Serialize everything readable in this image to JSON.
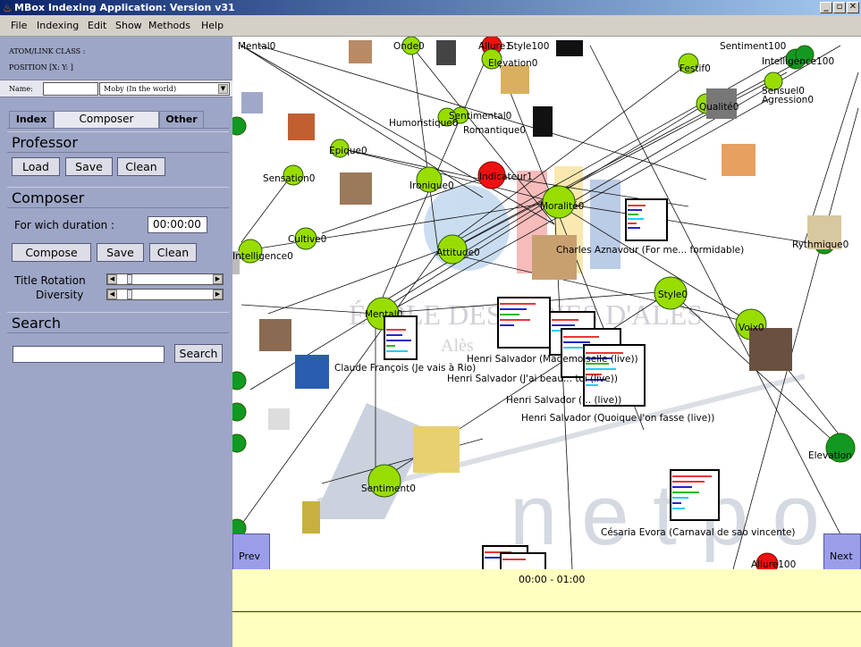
{
  "window": {
    "title": "MBox Indexing Application: Version v31"
  },
  "menu": [
    "File",
    "Indexing",
    "Edit",
    "Show",
    "Methods",
    "Help"
  ],
  "left_panel": {
    "atom_class": "ATOM/LINK CLASS :",
    "position": "POSITION [X:  Y:  ]",
    "name_label": "Name:",
    "name_value": "",
    "name_select": "Moby (In the world)",
    "tabs": {
      "index": "Index",
      "composer": "Composer",
      "other": "Other"
    },
    "professor": {
      "title": "Professor",
      "load": "Load",
      "save": "Save",
      "clean": "Clean"
    },
    "composer": {
      "title": "Composer",
      "duration_label": "For wich duration :",
      "duration_value": "00:00:00",
      "compose": "Compose",
      "save": "Save",
      "clean": "Clean",
      "title_rotation": "Title Rotation",
      "title_rotation_level": 0.1,
      "diversity": "Diversity",
      "diversity_level": 0.1
    },
    "search": {
      "title": "Search",
      "value": "",
      "button": "Search"
    }
  },
  "graph": {
    "watermark": {
      "school": "ÉCOLE DES MINES D'ALÈS",
      "city": "Alès",
      "word": "n e t p o"
    },
    "nodes": [
      {
        "label": "Mental0",
        "color": "#99dd00"
      },
      {
        "label": "Onde0",
        "color": "#99dd00"
      },
      {
        "label": "Allure1",
        "color": "#ee1111"
      },
      {
        "label": "Style100",
        "color": "#99dd00"
      },
      {
        "label": "Elevation0",
        "color": "#99dd00"
      },
      {
        "label": "Sentiment100",
        "color": "#99dd00"
      },
      {
        "label": "Festif0",
        "color": "#99dd00"
      },
      {
        "label": "Intelligence100",
        "color": "#119922"
      },
      {
        "label": "Sentimental0",
        "color": "#99dd00"
      },
      {
        "label": "Romantique0",
        "color": "#99dd00"
      },
      {
        "label": "Humoristique0",
        "color": "#99dd00"
      },
      {
        "label": "Qualité0",
        "color": "#99dd00"
      },
      {
        "label": "Sensuel0",
        "color": "#99dd00"
      },
      {
        "label": "Agression0",
        "color": "#99dd00"
      },
      {
        "label": "Epique0",
        "color": "#99dd00"
      },
      {
        "label": "Sensation0",
        "color": "#99dd00"
      },
      {
        "label": "Ironique0",
        "color": "#99dd00"
      },
      {
        "label": "Indicateur1",
        "color": "#ee1111"
      },
      {
        "label": "Moralité0",
        "color": "#99dd00"
      },
      {
        "label": "Cultive0",
        "color": "#99dd00"
      },
      {
        "label": "Intelligence0",
        "color": "#99dd00"
      },
      {
        "label": "Attitude0",
        "color": "#99dd00"
      },
      {
        "label": "Rythmique0",
        "color": "#119922"
      },
      {
        "label": "Style0",
        "color": "#99dd00"
      },
      {
        "label": "Voix0",
        "color": "#99dd00"
      },
      {
        "label": "Sentiment0",
        "color": "#99dd00"
      },
      {
        "label": "Elevation",
        "color": "#119922"
      },
      {
        "label": "Allure100",
        "color": "#ee1111"
      }
    ],
    "tracks": [
      "Charles Aznavour (For me... formidable)",
      "Claude François (Je vais à Rio)",
      "Henri Salvador (Mademoiselle (live))",
      "Henri Salvador (J'ai beau... toi (live))",
      "Henri Salvador (... (live))",
      "Henri Salvador (Quoique l'on fasse (live))",
      "Césaria Evora (Carnaval de sao vincente)"
    ],
    "buttons": {
      "prev": "Prev",
      "next": "Next"
    }
  },
  "timeline": {
    "range": "00:00 - 01:00"
  },
  "colors": {
    "panel": "#9da6c6",
    "timeline": "#ffffbf",
    "node_green": "#99dd00",
    "node_red": "#ee1111",
    "node_dark": "#119922"
  }
}
